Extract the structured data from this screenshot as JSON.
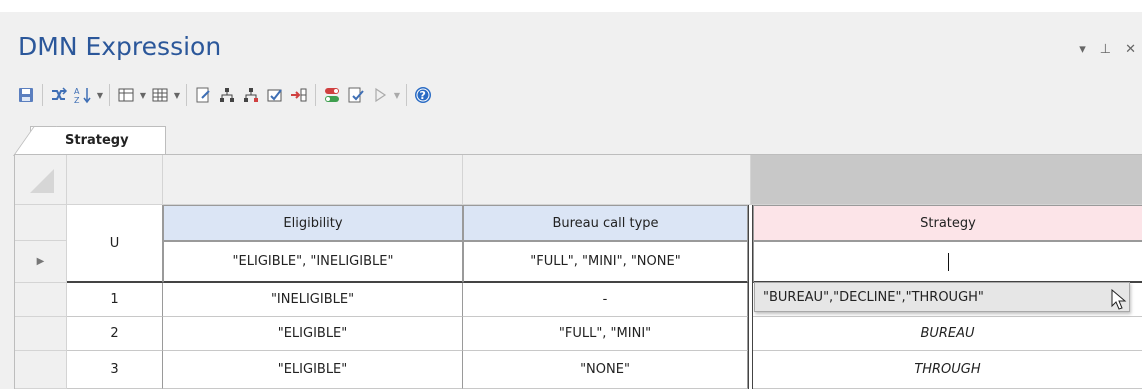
{
  "window": {
    "title": "DMN Expression",
    "controls": [
      "▾",
      "⊥",
      "✕"
    ]
  },
  "toolbar": {
    "buttons": [
      "save-icon",
      "shuffle-icon",
      "sort-az-icon",
      "table-columns-icon",
      "table-grid-icon",
      "edit-document-icon",
      "hierarchy-icon",
      "hierarchy-add-icon",
      "edit-check-icon",
      "insert-arrow-icon",
      "toggle-icon",
      "validate-icon",
      "play-icon",
      "help-icon"
    ]
  },
  "tabs": [
    {
      "label": "Strategy"
    }
  ],
  "table": {
    "hit_policy": "U",
    "inputs": [
      {
        "name": "Eligibility",
        "allowed_values": "\"ELIGIBLE\", \"INELIGIBLE\""
      },
      {
        "name": "Bureau call type",
        "allowed_values": "\"FULL\", \"MINI\", \"NONE\""
      }
    ],
    "output": {
      "name": "Strategy",
      "allowed_values": ""
    },
    "rows": [
      {
        "num": "1",
        "c1": "\"INELIGIBLE\"",
        "c2": "-",
        "out": ""
      },
      {
        "num": "2",
        "c1": "\"ELIGIBLE\"",
        "c2": "\"FULL\", \"MINI\"",
        "out": "BUREAU"
      },
      {
        "num": "3",
        "c1": "\"ELIGIBLE\"",
        "c2": "\"NONE\"",
        "out": "THROUGH"
      }
    ]
  },
  "dropdown": {
    "option": "\"BUREAU\",\"DECLINE\",\"THROUGH\""
  },
  "colors": {
    "title": "#2b579a",
    "input_header": "#dbe5f5",
    "output_header": "#fce4e8"
  }
}
